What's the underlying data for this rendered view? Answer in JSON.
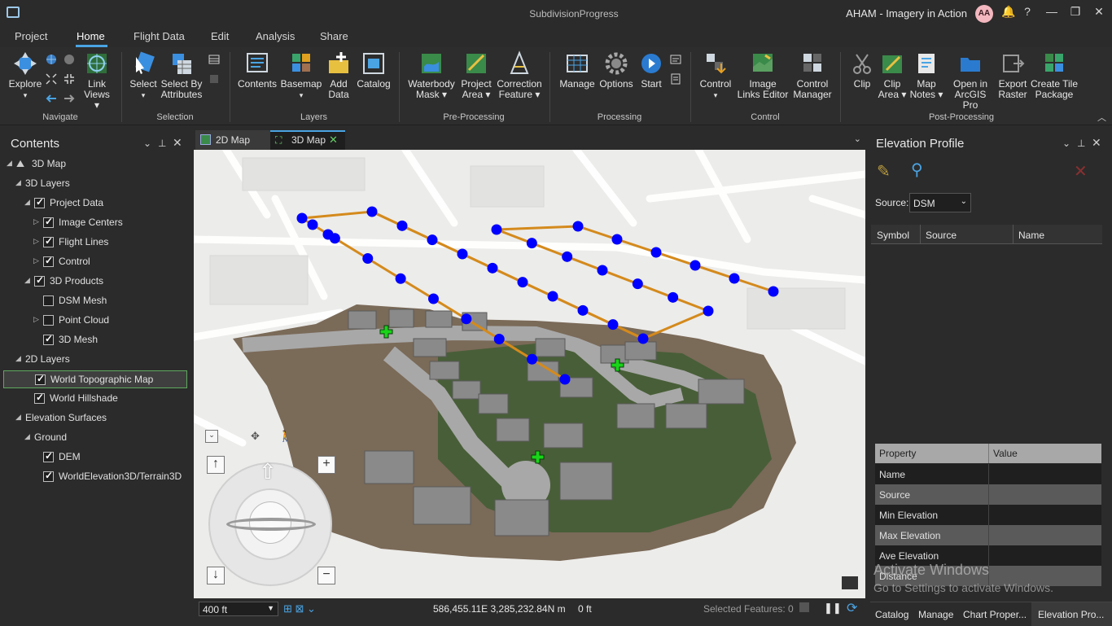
{
  "title": {
    "document": "SubdivisionProgress",
    "portal": "AHAM - Imagery in Action",
    "avatar": "AA"
  },
  "window_controls": {
    "help": "?",
    "minimize": "—",
    "restore": "❐",
    "close": "✕"
  },
  "menu_tabs": [
    "Project",
    "Home",
    "Flight Data",
    "Edit",
    "Analysis",
    "Share"
  ],
  "ribbon": {
    "explore": "Explore",
    "link_views": [
      "Link",
      "Views ▾"
    ],
    "select": "Select",
    "select_by_attributes": [
      "Select By",
      "Attributes"
    ],
    "contents": "Contents",
    "basemap": "Basemap",
    "add_data": [
      "Add",
      "Data"
    ],
    "catalog": "Catalog",
    "waterbody_mask": [
      "Waterbody",
      "Mask ▾"
    ],
    "project_area": [
      "Project",
      "Area ▾"
    ],
    "correction_feature": [
      "Correction",
      "Feature ▾"
    ],
    "manage": "Manage",
    "options": "Options",
    "start": "Start",
    "control": "Control",
    "image_links_editor": [
      "Image",
      "Links Editor"
    ],
    "control_manager": [
      "Control",
      "Manager"
    ],
    "clip": "Clip",
    "clip_area": [
      "Clip",
      "Area ▾"
    ],
    "map_notes": [
      "Map",
      "Notes ▾"
    ],
    "open_in_arcgis_pro": [
      "Open in",
      "ArcGIS Pro"
    ],
    "export_raster": [
      "Export",
      "Raster"
    ],
    "create_tile_package": [
      "Create Tile",
      "Package"
    ],
    "groups": [
      "Navigate",
      "Selection",
      "Layers",
      "Pre-Processing",
      "Processing",
      "Control",
      "Post-Processing"
    ]
  },
  "contents": {
    "title": "Contents",
    "tree": [
      {
        "label": "3D Map",
        "indent": 0,
        "checkbox": null,
        "arrow": "◢"
      },
      {
        "label": "3D Layers",
        "indent": 1,
        "checkbox": null,
        "arrow": "◢"
      },
      {
        "label": "Project Data",
        "indent": 2,
        "checkbox": true,
        "arrow": "◢"
      },
      {
        "label": "Image Centers",
        "indent": 3,
        "checkbox": true,
        "arrow": "▷"
      },
      {
        "label": "Flight Lines",
        "indent": 3,
        "checkbox": true,
        "arrow": "▷"
      },
      {
        "label": "Control",
        "indent": 3,
        "checkbox": true,
        "arrow": "▷"
      },
      {
        "label": "3D Products",
        "indent": 2,
        "checkbox": true,
        "arrow": "◢"
      },
      {
        "label": "DSM Mesh",
        "indent": 3,
        "checkbox": false,
        "arrow": ""
      },
      {
        "label": "Point Cloud",
        "indent": 3,
        "checkbox": false,
        "arrow": "▷"
      },
      {
        "label": "3D Mesh",
        "indent": 3,
        "checkbox": true,
        "arrow": ""
      },
      {
        "label": "2D Layers",
        "indent": 1,
        "checkbox": null,
        "arrow": "◢"
      },
      {
        "label": "World Topographic Map",
        "indent": 2,
        "checkbox": true,
        "arrow": "",
        "selected": true
      },
      {
        "label": "World Hillshade",
        "indent": 2,
        "checkbox": true,
        "arrow": ""
      },
      {
        "label": "Elevation Surfaces",
        "indent": 1,
        "checkbox": null,
        "arrow": "◢"
      },
      {
        "label": "Ground",
        "indent": 2,
        "checkbox": null,
        "arrow": "◢"
      },
      {
        "label": "DEM",
        "indent": 3,
        "checkbox": true,
        "arrow": ""
      },
      {
        "label": "WorldElevation3D/Terrain3D",
        "indent": 3,
        "checkbox": true,
        "arrow": ""
      }
    ]
  },
  "view_tabs": [
    "2D Map",
    "3D Map"
  ],
  "active_view_tab": "3D Map",
  "status": {
    "scale": "400 ft",
    "coordinates": "586,455.11E 3,285,232.84N m",
    "elevation": "0 ft",
    "selected_features": "Selected Features: 0"
  },
  "elevation_profile": {
    "title": "Elevation Profile",
    "source_label": "Source:",
    "source_value": "DSM",
    "table_headers": [
      "Symbol",
      "Source",
      "Name"
    ],
    "property_headers": [
      "Property",
      "Value"
    ],
    "properties": [
      "Name",
      "Source",
      "Min Elevation",
      "Max Elevation",
      "Ave Elevation",
      "Distance"
    ]
  },
  "bottom_tabs": [
    "Catalog",
    "Manage",
    "Chart Proper...",
    "Elevation Pro..."
  ],
  "watermark": {
    "line1": "Activate Windows",
    "line2": "Go to Settings to activate Windows."
  },
  "colors": {
    "accent": "#4aa4e3",
    "flight_point": "#0000ff",
    "flight_line": "#d48a1c",
    "control_point": "#19d419"
  }
}
